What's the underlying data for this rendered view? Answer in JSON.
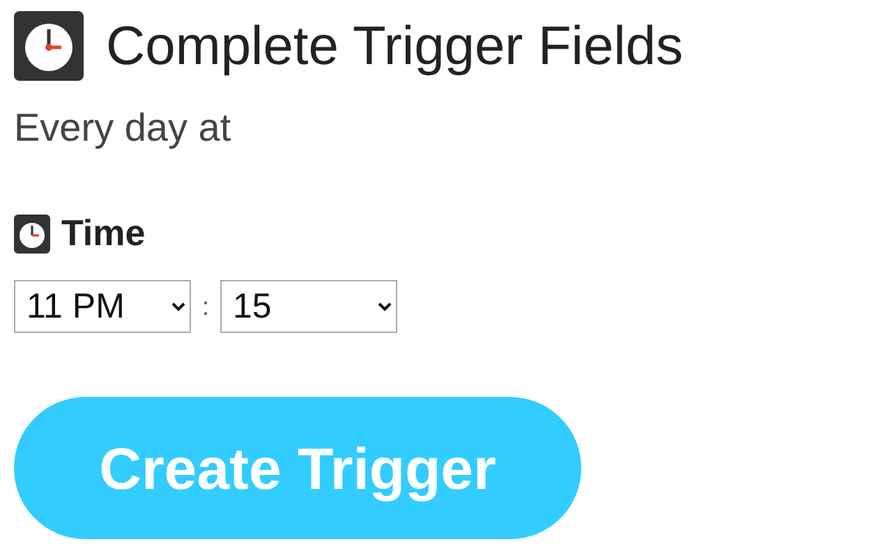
{
  "title": "Complete Trigger Fields",
  "description": "Every day at",
  "field": {
    "label": "Time",
    "hour": "11 PM",
    "separator": ":",
    "minute": "15"
  },
  "button": "Create Trigger"
}
